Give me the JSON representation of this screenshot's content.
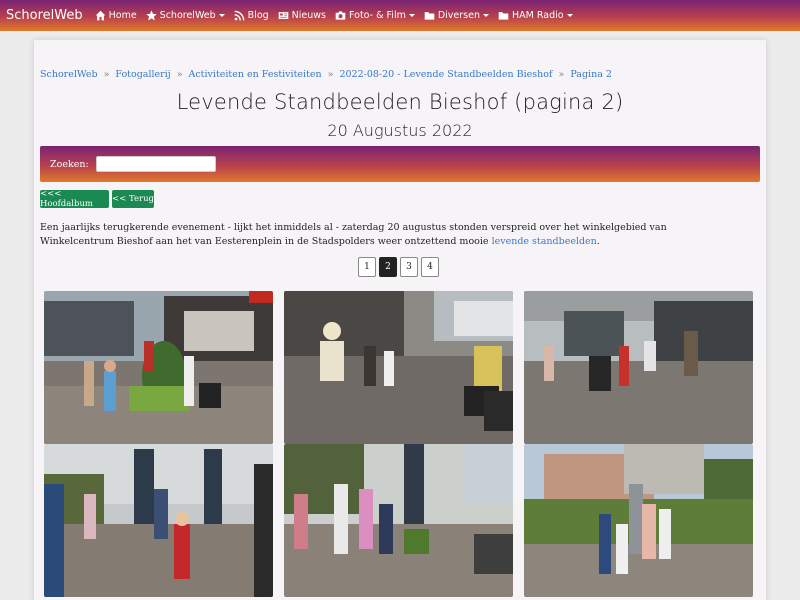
{
  "navbar": {
    "brand": "SchorelWeb",
    "items": [
      {
        "label": "Home",
        "icon": "home-icon",
        "dropdown": false
      },
      {
        "label": "SchorelWeb",
        "icon": "star-icon",
        "dropdown": true
      },
      {
        "label": "Blog",
        "icon": "rss-icon",
        "dropdown": false
      },
      {
        "label": "Nieuws",
        "icon": "newspaper-icon",
        "dropdown": false
      },
      {
        "label": "Foto- & Film",
        "icon": "camera-icon",
        "dropdown": true
      },
      {
        "label": "Diversen",
        "icon": "folder-icon",
        "dropdown": true
      },
      {
        "label": "HAM Radio",
        "icon": "folder-icon",
        "dropdown": true
      }
    ]
  },
  "breadcrumb": [
    "SchorelWeb",
    "Fotogallerij",
    "Activiteiten en Festiviteiten",
    "2022-08-20 - Levende Standbeelden Bieshof",
    "Pagina 2"
  ],
  "title": "Levende Standbeelden Bieshof (pagina 2)",
  "subtitle": "20 Augustus 2022",
  "search": {
    "label": "Zoeken:",
    "value": ""
  },
  "buttons": {
    "main_album": "<<< Hoofdalbum",
    "back": "<< Terug"
  },
  "intro": {
    "text": "Een jaarlijks terugkerende evenement - lijkt het inmiddels al - zaterdag 20 augustus stonden verspreid over het winkelgebied van Winkelcentrum Bieshof aan het van Eesterenplein in de Stadspolders weer ontzettend mooie ",
    "link": "levende standbeelden",
    "end": "."
  },
  "pagination": {
    "pages": [
      "1",
      "2",
      "3",
      "4"
    ],
    "active": "2"
  },
  "colors": {
    "accent_start": "#7a2374",
    "accent_end": "#e07a2a",
    "button": "#1b8a52",
    "link": "#3a78c8"
  }
}
